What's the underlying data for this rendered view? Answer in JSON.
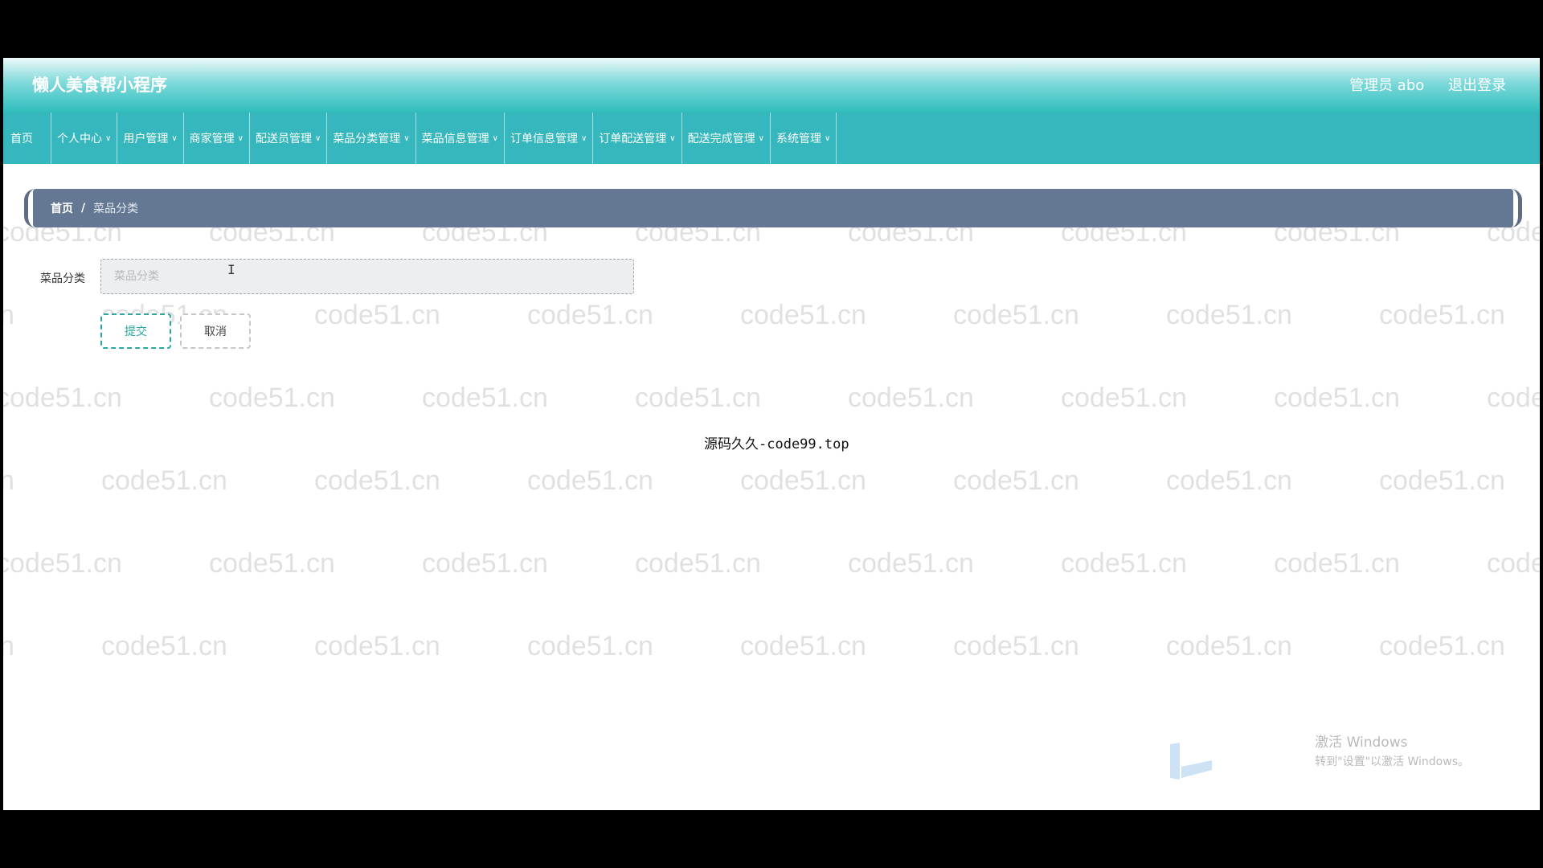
{
  "header": {
    "app_title": "懒人美食帮小程序",
    "user_label": "管理员 abo",
    "logout_label": "退出登录"
  },
  "nav": [
    {
      "label": "首页",
      "has_dropdown": false
    },
    {
      "label": "个人中心",
      "has_dropdown": true
    },
    {
      "label": "用户管理",
      "has_dropdown": true
    },
    {
      "label": "商家管理",
      "has_dropdown": true
    },
    {
      "label": "配送员管理",
      "has_dropdown": true
    },
    {
      "label": "菜品分类管理",
      "has_dropdown": true
    },
    {
      "label": "菜品信息管理",
      "has_dropdown": true
    },
    {
      "label": "订单信息管理",
      "has_dropdown": true
    },
    {
      "label": "订单配送管理",
      "has_dropdown": true
    },
    {
      "label": "配送完成管理",
      "has_dropdown": true
    },
    {
      "label": "系统管理",
      "has_dropdown": true
    }
  ],
  "breadcrumb": {
    "home": "首页",
    "separator": "/",
    "current": "菜品分类"
  },
  "form": {
    "field_label": "菜品分类",
    "field_placeholder": "菜品分类",
    "field_value": "",
    "submit_label": "提交",
    "cancel_label": "取消"
  },
  "overlay": {
    "source_text": "源码久久-code99.top",
    "watermark_text": "code51.cn",
    "activation_title": "激活 Windows",
    "activation_sub": "转到\"设置\"以激活 Windows。"
  },
  "colors": {
    "header_gradient_bottom": "#2fbdbc",
    "navbar": "#35b7bd",
    "breadcrumb_bg": "#647893",
    "submit_accent": "#2aa79f"
  }
}
